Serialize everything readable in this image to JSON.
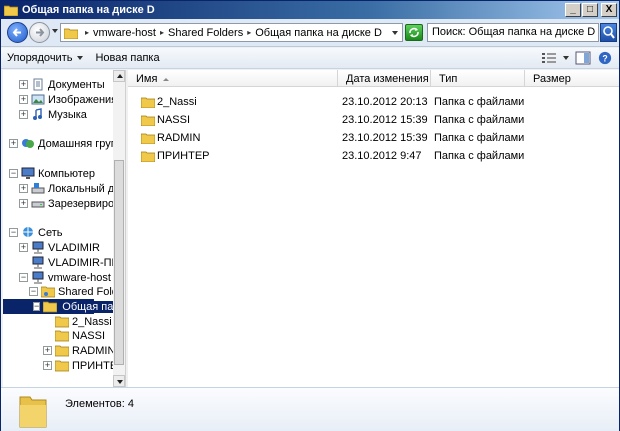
{
  "window": {
    "title": "Общая папка на диске D",
    "min": "_",
    "max": "□",
    "close": "X"
  },
  "address": {
    "crumbs": [
      "vmware-host",
      "Shared Folders",
      "Общая папка на диске D"
    ]
  },
  "search": {
    "value": "Поиск: Общая папка на диске D"
  },
  "toolbar": {
    "organize": "Упорядочить",
    "new_folder": "Новая папка"
  },
  "nav_tree": [
    {
      "label": "Документы",
      "expander": "+",
      "icon": "document-library-icon"
    },
    {
      "label": "Изображения",
      "expander": "+",
      "icon": "pictures-library-icon"
    },
    {
      "label": "Музыка",
      "expander": "+",
      "icon": "music-library-icon"
    },
    {
      "label": "Домашняя группа",
      "expander": "+",
      "icon": "homegroup-icon"
    },
    {
      "label": "Компьютер",
      "expander": "−",
      "icon": "computer-icon"
    },
    {
      "label": "Локальный диск (",
      "expander": "+",
      "icon": "local-disk-icon"
    },
    {
      "label": "Зарезервировано",
      "expander": "+",
      "icon": "drive-icon"
    },
    {
      "label": "Сеть",
      "expander": "−",
      "icon": "network-icon"
    },
    {
      "label": "VLADIMIR",
      "expander": "+",
      "icon": "network-computer-icon"
    },
    {
      "label": "VLADIMIR-ПК",
      "expander": "",
      "icon": "network-computer-icon"
    },
    {
      "label": "vmware-host",
      "expander": "−",
      "icon": "network-computer-icon"
    },
    {
      "label": "Shared Folders",
      "expander": "−",
      "icon": "shared-folder-icon"
    },
    {
      "label": "Общая папка",
      "expander": "−",
      "icon": "folder-icon"
    },
    {
      "label": "2_Nassi",
      "expander": "",
      "icon": "folder-icon"
    },
    {
      "label": "NASSI",
      "expander": "",
      "icon": "folder-icon"
    },
    {
      "label": "RADMIN",
      "expander": "+",
      "icon": "folder-icon"
    },
    {
      "label": "ПРИНТЕР",
      "expander": "+",
      "icon": "folder-icon"
    }
  ],
  "columns": {
    "name": "Имя",
    "date": "Дата изменения",
    "type": "Тип",
    "size": "Размер"
  },
  "files": [
    {
      "name": "2_Nassi",
      "date": "23.10.2012 20:13",
      "type": "Папка с файлами",
      "size": ""
    },
    {
      "name": "NASSI",
      "date": "23.10.2012 15:39",
      "type": "Папка с файлами",
      "size": ""
    },
    {
      "name": "RADMIN",
      "date": "23.10.2012 15:39",
      "type": "Папка с файлами",
      "size": ""
    },
    {
      "name": "ПРИНТЕР",
      "date": "23.10.2012 9:47",
      "type": "Папка с файлами",
      "size": ""
    }
  ],
  "details": {
    "count": "Элементов: 4"
  },
  "colors": {
    "folder": "#e8c14a",
    "selection": "#0a246a",
    "title_bar": "#0a246a"
  }
}
